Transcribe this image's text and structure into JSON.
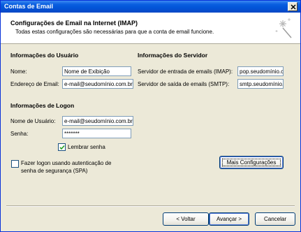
{
  "window": {
    "title": "Contas de Email"
  },
  "header": {
    "title": "Configurações de Email na Internet (IMAP)",
    "subtitle": "Todas estas configurações são necessárias para que a conta de email funcione."
  },
  "user_info": {
    "title": "Informações do Usuário",
    "name_label": "Nome:",
    "name_value": "Nome de Exibição",
    "email_label": "Endereço de Email:",
    "email_value": "e-mail@seudomínio.com.br"
  },
  "server_info": {
    "title": "Informações do Servidor",
    "incoming_label": "Servidor de entrada de emails (IMAP):",
    "incoming_value": "pop.seudomínio.c",
    "outgoing_label": "Servidor de saída de emails (SMTP):",
    "outgoing_value": "smtp.seudomínio."
  },
  "logon_info": {
    "title": "Informações de Logon",
    "username_label": "Nome de Usuário:",
    "username_value": "e-mail@seudomínio.com.br",
    "password_label": "Senha:",
    "password_value": "*******",
    "remember_label": "Lembrar senha",
    "remember_checked": true,
    "spa_label_line1": "Fazer logon usando autenticação de",
    "spa_label_line2": "senha de segurança (SPA)",
    "spa_checked": false
  },
  "buttons": {
    "more_settings": "Mais Configurações",
    "back": "< Voltar",
    "next": "Avançar >",
    "cancel": "Cancelar"
  }
}
